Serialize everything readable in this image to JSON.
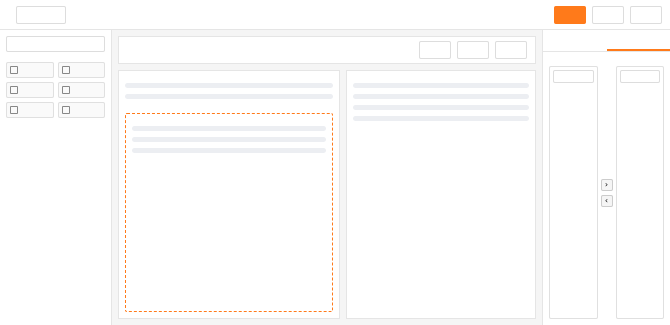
{
  "note": "",
  "header": {
    "title": "",
    "device_select": "",
    "actions": []
  },
  "palette": {
    "search_placeholder": "",
    "group_label": "",
    "items": []
  },
  "canvas": {
    "record_title": "",
    "header_actions": [],
    "left_section_title": "",
    "tabs": [],
    "drop_zone_label": "",
    "right_section_title": ""
  },
  "settings": {
    "tabs": [],
    "heading": "",
    "sub_label": "",
    "search_placeholder": "",
    "left_items": [],
    "right_items": []
  },
  "colors": {
    "accent": "#ff7a1a"
  }
}
